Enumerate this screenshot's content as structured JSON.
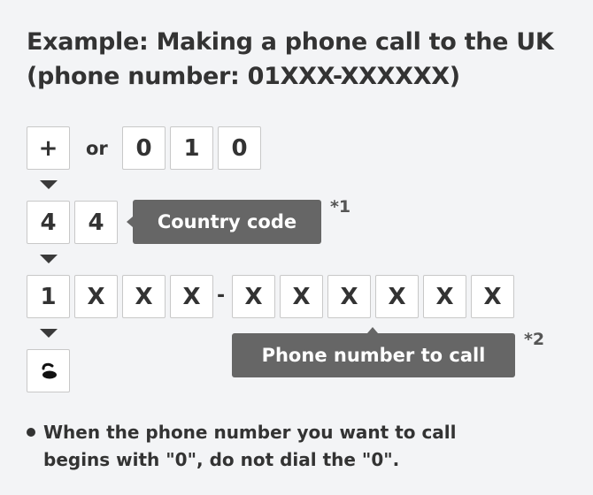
{
  "title": {
    "line1": "Example: Making a phone call to the UK",
    "line2": "(phone number: 01XXX-XXXXXX)"
  },
  "steps": {
    "international_prefix": {
      "plus": "+",
      "or_label": "or",
      "digits": [
        "0",
        "1",
        "0"
      ]
    },
    "country_code": {
      "digits": [
        "4",
        "4"
      ],
      "callout": "Country code",
      "note": "*1"
    },
    "phone_number": {
      "area_digits": [
        "1",
        "X",
        "X",
        "X"
      ],
      "separator": "-",
      "local_digits": [
        "X",
        "X",
        "X",
        "X",
        "X",
        "X"
      ],
      "callout": "Phone number to call",
      "note": "*2"
    },
    "call": {
      "icon": "phone-handset-icon"
    }
  },
  "notes": [
    "When the phone number you want to call begins with \"0\", do not dial the \"0\"."
  ],
  "colors": {
    "background": "#f3f4f6",
    "callout": "#666666",
    "text": "#333333"
  }
}
